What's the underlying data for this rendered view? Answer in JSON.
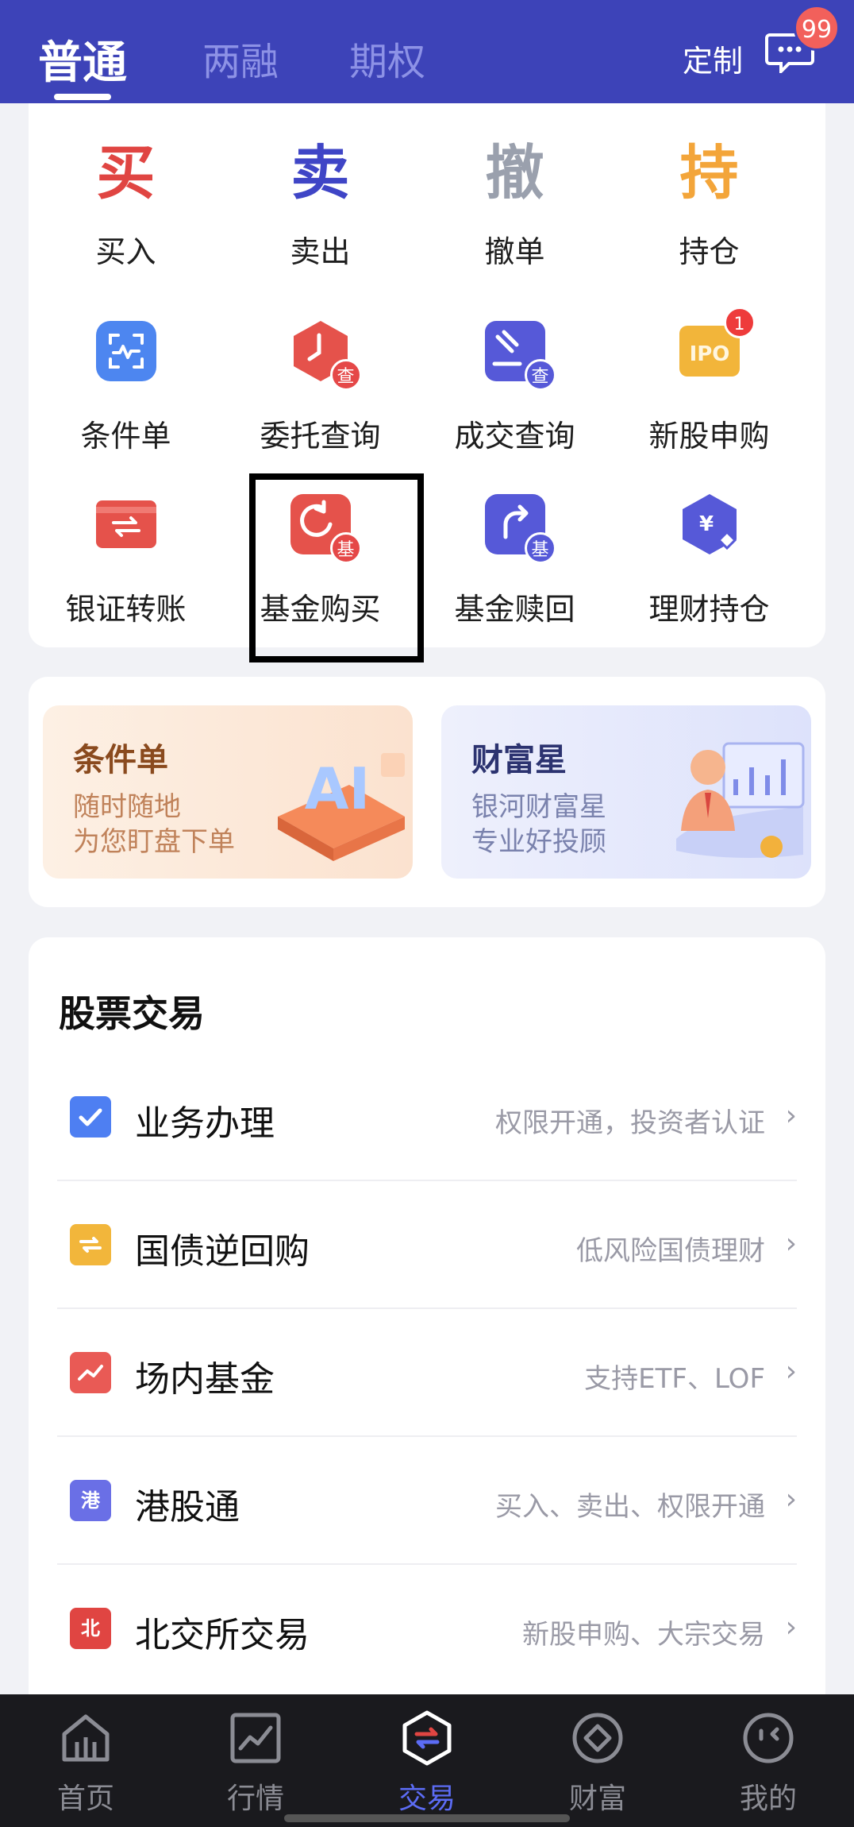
{
  "header": {
    "tabs": [
      {
        "label": "普通",
        "active": true
      },
      {
        "label": "两融",
        "active": false
      },
      {
        "label": "期权",
        "active": false
      }
    ],
    "custom_label": "定制",
    "message_count": "99",
    "bg_color": "#3d43b8"
  },
  "actions": {
    "big": [
      {
        "char": "买",
        "label": "买入",
        "color": "#e04542"
      },
      {
        "char": "卖",
        "label": "卖出",
        "color": "#3f45c6"
      },
      {
        "char": "撤",
        "label": "撤单",
        "color": "#9aa0ad"
      },
      {
        "char": "持",
        "label": "持仓",
        "color": "#f3a53a"
      }
    ],
    "row2": [
      {
        "label": "条件单",
        "icon": "scan-icon"
      },
      {
        "label": "委托查询",
        "icon": "clock-query-icon",
        "badge": "查"
      },
      {
        "label": "成交查询",
        "icon": "gavel-query-icon",
        "badge": "查"
      },
      {
        "label": "新股申购",
        "icon": "ipo-icon",
        "icon_text": "IPO",
        "count": "1"
      }
    ],
    "row3": [
      {
        "label": "银证转账",
        "icon": "card-transfer-icon"
      },
      {
        "label": "基金购买",
        "icon": "fund-buy-icon",
        "badge": "基"
      },
      {
        "label": "基金赎回",
        "icon": "fund-redeem-icon",
        "badge": "基"
      },
      {
        "label": "理财持仓",
        "icon": "wealth-holding-icon",
        "icon_text": "¥"
      }
    ]
  },
  "promo": {
    "left": {
      "title": "条件单",
      "line1": "随时随地",
      "line2": "为您盯盘下单",
      "art_text": "AI"
    },
    "right": {
      "title": "财富星",
      "line1": "银河财富星",
      "line2": "专业好投顾"
    }
  },
  "stock": {
    "title": "股票交易",
    "rows": [
      {
        "title": "业务办理",
        "sub": "权限开通，投资者认证",
        "icon": "checkbox-icon",
        "color": "#4e7ff2",
        "glyph": ""
      },
      {
        "title": "国债逆回购",
        "sub": "低风险国债理财",
        "icon": "repo-icon",
        "color": "#f2b63b",
        "glyph": ""
      },
      {
        "title": "场内基金",
        "sub": "支持ETF、LOF",
        "icon": "chart-icon",
        "color": "#e95a55",
        "glyph": ""
      },
      {
        "title": "港股通",
        "sub": "买入、卖出、权限开通",
        "icon": "hk-icon",
        "color": "#6a6fe6",
        "glyph": "港"
      },
      {
        "title": "北交所交易",
        "sub": "新股申购、大宗交易",
        "icon": "bj-icon",
        "color": "#e04542",
        "glyph": "北"
      }
    ]
  },
  "nav": {
    "items": [
      {
        "label": "首页",
        "icon": "home-icon",
        "active": false
      },
      {
        "label": "行情",
        "icon": "market-icon",
        "active": false
      },
      {
        "label": "交易",
        "icon": "trade-icon",
        "active": true
      },
      {
        "label": "财富",
        "icon": "wealth-icon",
        "active": false
      },
      {
        "label": "我的",
        "icon": "profile-icon",
        "active": false
      }
    ],
    "active_color": "#5c6cf5"
  }
}
